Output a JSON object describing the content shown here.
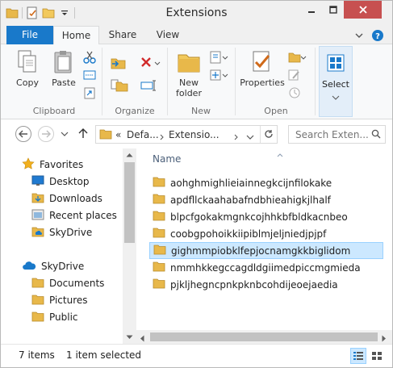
{
  "window": {
    "title": "Extensions"
  },
  "ribbon_tabs": {
    "file": "File",
    "home": "Home",
    "share": "Share",
    "view": "View"
  },
  "ribbon": {
    "clipboard": {
      "copy": "Copy",
      "paste": "Paste",
      "label": "Clipboard"
    },
    "organize": {
      "label": "Organize"
    },
    "new": {
      "new_folder_line1": "New",
      "new_folder_line2": "folder",
      "label": "New"
    },
    "open": {
      "properties": "Properties",
      "label": "Open"
    },
    "select": {
      "select": "Select"
    }
  },
  "address": {
    "chevrons": "«",
    "segments": [
      "Defa...",
      "Extensio..."
    ],
    "search_placeholder": "Search Exten..."
  },
  "nav_pane": {
    "favorites_label": "Favorites",
    "favorites": [
      "Desktop",
      "Downloads",
      "Recent places",
      "SkyDrive"
    ],
    "skydrive_label": "SkyDrive",
    "skydrive": [
      "Documents",
      "Pictures",
      "Public"
    ]
  },
  "file_list": {
    "column_name": "Name",
    "items": [
      "aohghmighlieiainnegkcijnfilokake",
      "apdfllckaahabafndbhieahigkjlhalf",
      "blpcfgokakmgnkcojhhkbfbldkacnbeo",
      "coobgpohoikkiipiblmjeljniedjpjpf",
      "gighmmpiobklfepjocnamgkkbiglidom",
      "nmmhkkegccagdldgiimedpiccmgmieda",
      "pjkljhegncpnkpknbcohdijeoejaedia"
    ],
    "selected_index": 4
  },
  "status": {
    "count": "7 items",
    "selection": "1 item selected"
  },
  "colors": {
    "accent": "#1979ca",
    "selection": "#cce8ff",
    "close": "#c75050",
    "folder": "#e8b84a"
  }
}
